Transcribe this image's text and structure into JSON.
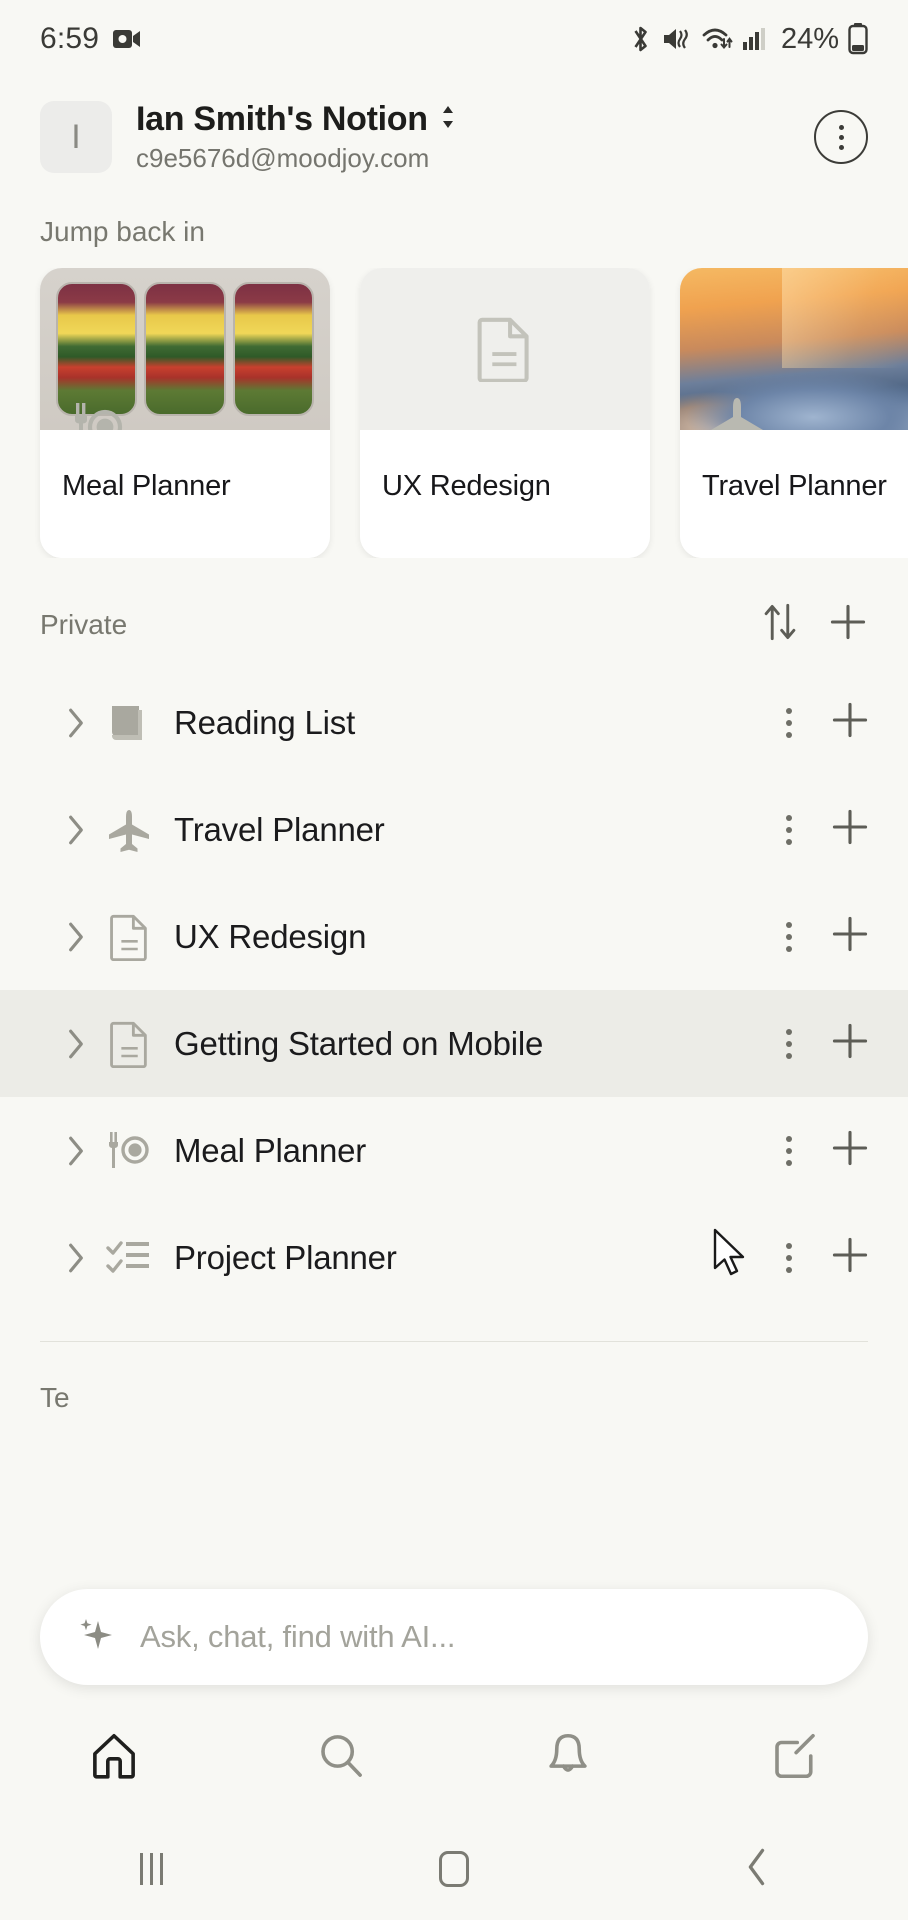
{
  "statusbar": {
    "time": "6:59",
    "battery_percent": "24%",
    "icons": [
      "video-camera-icon",
      "bluetooth-icon",
      "mute-vibrate-icon",
      "wifi-icon",
      "cellular-signal-icon",
      "battery-icon"
    ]
  },
  "workspace": {
    "avatar_letter": "I",
    "title": "Ian Smith's Notion",
    "email": "c9e5676d@moodjoy.com",
    "switcher_icon": "chevron-up-down-icon",
    "more_icon": "more-options-icon"
  },
  "jump_back_in": {
    "label": "Jump back in",
    "cards": [
      {
        "title": "Meal Planner",
        "cover": "meal-prep-photo",
        "icon": "fork-and-plate-icon"
      },
      {
        "title": "UX Redesign",
        "cover": "blank",
        "icon": "document-icon"
      },
      {
        "title": "Travel Planner",
        "cover": "sunset-clouds-photo",
        "icon": "airplane-icon"
      }
    ]
  },
  "private": {
    "label": "Private",
    "sort_icon": "sort-arrows-icon",
    "add_icon": "plus-icon",
    "items": [
      {
        "title": "Reading List",
        "icon": "book-icon",
        "caret": "chevron-right-icon",
        "active": false
      },
      {
        "title": "Travel Planner",
        "icon": "airplane-icon",
        "caret": "chevron-right-icon",
        "active": false
      },
      {
        "title": "UX Redesign",
        "icon": "document-icon",
        "caret": "chevron-right-icon",
        "active": false
      },
      {
        "title": "Getting Started on Mobile",
        "icon": "document-icon",
        "caret": "chevron-right-icon",
        "active": true
      },
      {
        "title": "Meal Planner",
        "icon": "fork-and-plate-icon",
        "caret": "chevron-right-icon",
        "active": false
      },
      {
        "title": "Project Planner",
        "icon": "checklist-icon",
        "caret": "chevron-right-icon",
        "active": false
      }
    ],
    "row_more_icon": "more-options-icon",
    "row_add_icon": "plus-icon"
  },
  "teamspace": {
    "label": "Te"
  },
  "ai_bar": {
    "placeholder": "Ask, chat, find with AI...",
    "icon": "ai-sparkle-icon"
  },
  "bottom_nav": {
    "items": [
      {
        "name": "home",
        "icon": "home-icon",
        "active": true
      },
      {
        "name": "search",
        "icon": "search-icon",
        "active": false
      },
      {
        "name": "inbox",
        "icon": "bell-icon",
        "active": false
      },
      {
        "name": "new-page",
        "icon": "compose-icon",
        "active": false
      }
    ]
  },
  "android_nav": {
    "items": [
      {
        "name": "recents",
        "icon": "recents-bars-icon"
      },
      {
        "name": "home",
        "icon": "home-square-icon"
      },
      {
        "name": "back",
        "icon": "back-chevron-icon"
      }
    ]
  },
  "colors": {
    "background": "#f8f8f4",
    "card_surface": "#ffffff",
    "active_row": "#ecece7",
    "text_primary": "#1b1b1d",
    "text_secondary": "#78786f",
    "icon_muted": "#a8a8a0"
  }
}
